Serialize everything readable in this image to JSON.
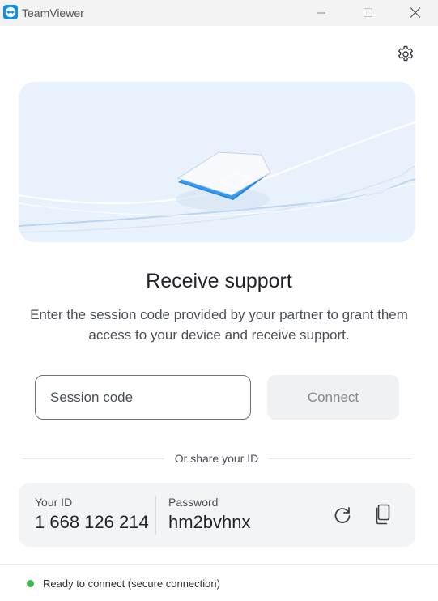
{
  "window": {
    "title": "TeamViewer",
    "controls": [
      "minimize-icon",
      "maximize-icon",
      "close-icon"
    ]
  },
  "settings": {
    "icon": "gear-icon"
  },
  "main": {
    "heading": "Receive support",
    "description": "Enter the session code provided by your partner to grant them access to your device and receive support.",
    "session_input": {
      "placeholder": "Session code",
      "value": ""
    },
    "connect_label": "Connect",
    "divider_text": "Or share your ID"
  },
  "id_card": {
    "your_id_label": "Your ID",
    "your_id_value": "1 668 126 214",
    "password_label": "Password",
    "password_value": "hm2bvhnx",
    "refresh_icon": "refresh-icon",
    "copy_icon": "copy-icon"
  },
  "status": {
    "text": "Ready to connect (secure connection)",
    "color": "#3fb54a"
  },
  "colors": {
    "accent": "#0e8ee9",
    "hero_background": "#e9f2fc"
  }
}
